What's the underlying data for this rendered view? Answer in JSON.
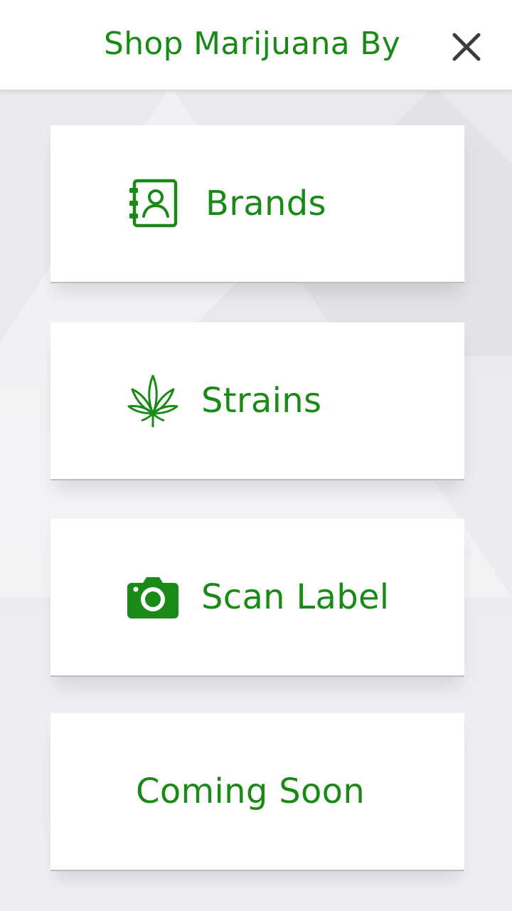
{
  "header": {
    "title": "Shop Marijuana By",
    "close_icon": "close-icon"
  },
  "options": {
    "brands": {
      "label": "Brands",
      "icon": "contact-book-icon"
    },
    "strains": {
      "label": "Strains",
      "icon": "cannabis-leaf-icon"
    },
    "scan_label": {
      "label": "Scan Label",
      "icon": "camera-icon"
    },
    "coming_soon": {
      "label": "Coming Soon"
    }
  },
  "colors": {
    "accent": "#1a8a17",
    "close": "#3c3c3c",
    "background": "#e9eaee",
    "card": "#ffffff"
  }
}
